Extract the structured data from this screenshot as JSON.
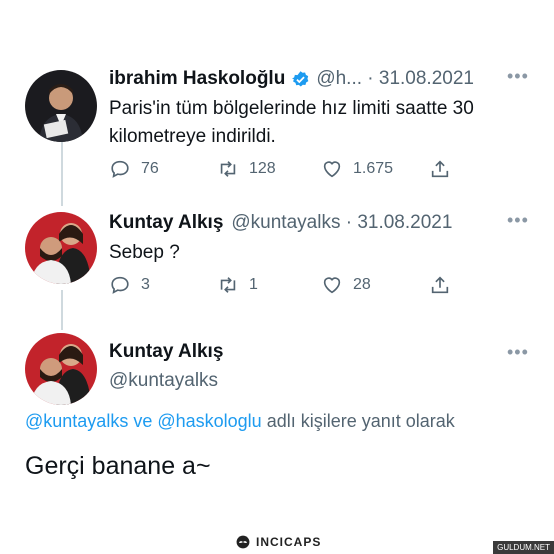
{
  "tweet1": {
    "name": "ibrahim Haskoloğlu",
    "handle_date": "@h... · 31.08.2021",
    "text_line1": "Paris'in tüm bölgelerinde hız limiti saatte 30",
    "text_line2": "kilometreye indirildi.",
    "replies": "76",
    "retweets": "128",
    "likes": "1.675"
  },
  "tweet2": {
    "name": "Kuntay Alkış",
    "handle_date": "@kuntayalks · 31.08.2021",
    "text": "Sebep ?",
    "replies": "3",
    "retweets": "1",
    "likes": "28"
  },
  "tweet3": {
    "name": "Kuntay Alkış",
    "handle": "@kuntayalks",
    "reply_to_user1": "@kuntayalks",
    "reply_to_and": " ve ",
    "reply_to_user2": "@haskologlu",
    "reply_to_suffix": " adlı kişilere yanıt olarak",
    "text": "Gerçi banane a~"
  },
  "footer": {
    "brand": "INCICAPS",
    "watermark": "GULDUM.NET"
  },
  "colors": {
    "verified": "#1d9bf0",
    "link": "#1d9bf0",
    "muted": "#536471"
  }
}
